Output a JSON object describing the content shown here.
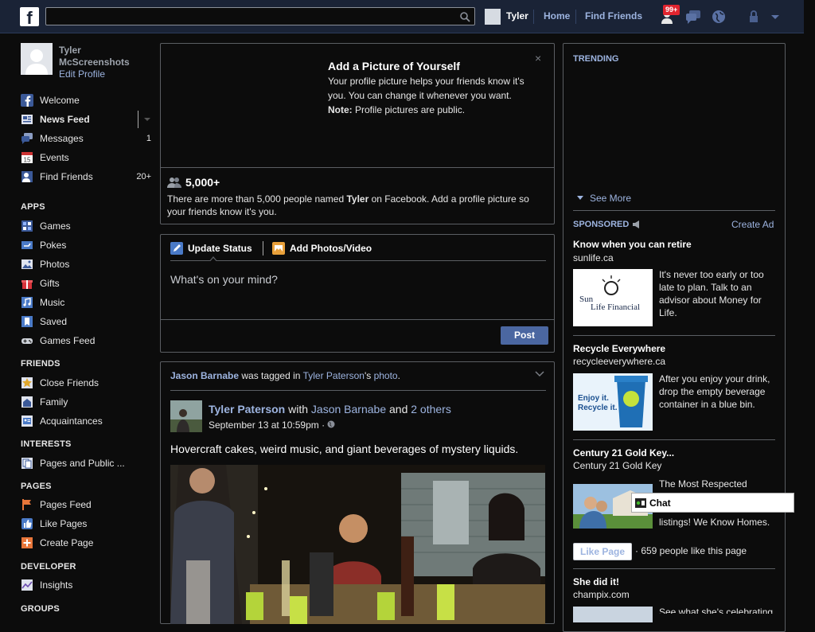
{
  "topbar": {
    "logo": "f",
    "search_value": "",
    "user_name": "Tyler",
    "home": "Home",
    "find_friends": "Find Friends",
    "notif_badge": "99+"
  },
  "leftnav": {
    "user_name": "Tyler McScreenshots",
    "edit_profile": "Edit Profile",
    "main": [
      {
        "label": "Welcome",
        "count": "",
        "icon": "facebook-icon"
      },
      {
        "label": "News Feed",
        "count": "",
        "icon": "news-feed-icon"
      },
      {
        "label": "Messages",
        "count": "1",
        "icon": "messages-icon"
      },
      {
        "label": "Events",
        "count": "",
        "icon": "calendar-icon"
      },
      {
        "label": "Find Friends",
        "count": "20+",
        "icon": "find-friends-icon"
      }
    ],
    "apps_head": "APPS",
    "apps": [
      {
        "label": "Games",
        "icon": "games-icon"
      },
      {
        "label": "Pokes",
        "icon": "pokes-icon"
      },
      {
        "label": "Photos",
        "icon": "photos-icon"
      },
      {
        "label": "Gifts",
        "icon": "gift-icon"
      },
      {
        "label": "Music",
        "icon": "music-icon"
      },
      {
        "label": "Saved",
        "icon": "bookmark-icon"
      },
      {
        "label": "Games Feed",
        "icon": "gamepad-icon"
      }
    ],
    "friends_head": "FRIENDS",
    "friends": [
      {
        "label": "Close Friends",
        "icon": "star-icon"
      },
      {
        "label": "Family",
        "icon": "family-icon"
      },
      {
        "label": "Acquaintances",
        "icon": "acquaintances-icon"
      }
    ],
    "interests_head": "INTERESTS",
    "interests": [
      {
        "label": "Pages and Public ...",
        "icon": "pages-list-icon"
      }
    ],
    "pages_head": "PAGES",
    "pages": [
      {
        "label": "Pages Feed",
        "icon": "flag-icon"
      },
      {
        "label": "Like Pages",
        "icon": "thumbs-up-icon"
      },
      {
        "label": "Create Page",
        "icon": "plus-icon"
      }
    ],
    "developer_head": "DEVELOPER",
    "developer": [
      {
        "label": "Insights",
        "icon": "insights-icon"
      }
    ],
    "groups_head": "GROUPS"
  },
  "profile_card": {
    "title": "Add a Picture of Yourself",
    "body": "Your profile picture helps your friends know it's you. You can change it whenever you want.",
    "note_label": "Note:",
    "note_text": " Profile pictures are public.",
    "close": "×",
    "count": "5,000+",
    "info_pre": "There are more than 5,000 people named ",
    "info_name": "Tyler",
    "info_post": " on Facebook. Add a profile picture so your friends know it's you."
  },
  "composer": {
    "tab_status": "Update Status",
    "tab_photo": "Add Photos/Video",
    "placeholder": "What's on your mind?",
    "post": "Post"
  },
  "story": {
    "actor": "Jason Barnabe",
    "was_tagged": " was tagged in ",
    "owner": "Tyler Paterson",
    "possessive": "'s ",
    "photo": "photo",
    "period": ".",
    "author": "Tyler Paterson",
    "with": " with ",
    "tagged": "Jason Barnabe",
    "and": " and ",
    "others": "2 others",
    "time": "September 13 at 10:59pm · ",
    "text": "Hovercraft cakes, weird music, and giant beverages of mystery liquids."
  },
  "right": {
    "trending": "TRENDING",
    "see_more": "See More",
    "sponsored": "SPONSORED",
    "create_ad": "Create Ad",
    "ads": [
      {
        "title": "Know when you can retire",
        "url": "sunlife.ca",
        "text": "It's never too early or too late to plan. Talk to an advisor about Money for Life.",
        "img_text": "Sun Life Financial"
      },
      {
        "title": "Recycle Everywhere",
        "url": "recycleeverywhere.ca",
        "text": "After you enjoy your drink, drop the empty beverage container in a blue bin.",
        "img_text": "Enjoy it. Recycle it."
      },
      {
        "title": "Century 21 Gold Key...",
        "url": "Century 21 Gold Key",
        "text": "The Most Respected",
        "text2": "listings! We Know Homes."
      },
      {
        "title": "She did it!",
        "url": "champix.com",
        "text": "See what she's celebrating"
      }
    ],
    "like_page": "Like Page",
    "like_count": "· 659 people like this page"
  },
  "chat": {
    "label": "Chat"
  }
}
